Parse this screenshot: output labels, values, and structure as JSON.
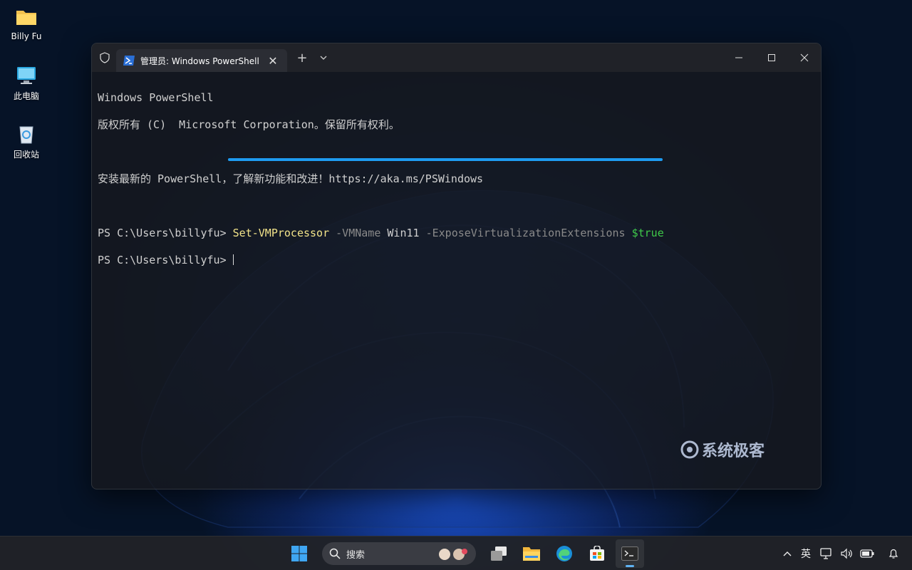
{
  "desktop": {
    "icons": [
      {
        "label": "Billy Fu",
        "icon": "folder-icon"
      },
      {
        "label": "此电脑",
        "icon": "computer-icon"
      },
      {
        "label": "回收站",
        "icon": "recycle-bin-icon"
      }
    ]
  },
  "terminal": {
    "tab_title": "管理员: Windows PowerShell",
    "new_tab": "+",
    "lines": {
      "l1": "Windows PowerShell",
      "l2": "版权所有 (C)  Microsoft Corporation。保留所有权利。",
      "l3": "安装最新的 PowerShell，了解新功能和改进！https://aka.ms/PSWindows",
      "prompt": "PS C:\\Users\\billyfu> ",
      "cmd": "Set-VMProcessor",
      "p1": " -VMName",
      "a1": " Win11",
      "p2": " -ExposeVirtualizationExtensions",
      "bool": " $true"
    },
    "accent_color": "#1e9bf0"
  },
  "watermark": "系统极客",
  "taskbar": {
    "search_placeholder": "搜索",
    "ime": "英",
    "apps": [
      "windows-start-icon",
      "task-view-icon",
      "file-explorer-icon",
      "edge-icon",
      "store-icon",
      "terminal-icon"
    ]
  }
}
